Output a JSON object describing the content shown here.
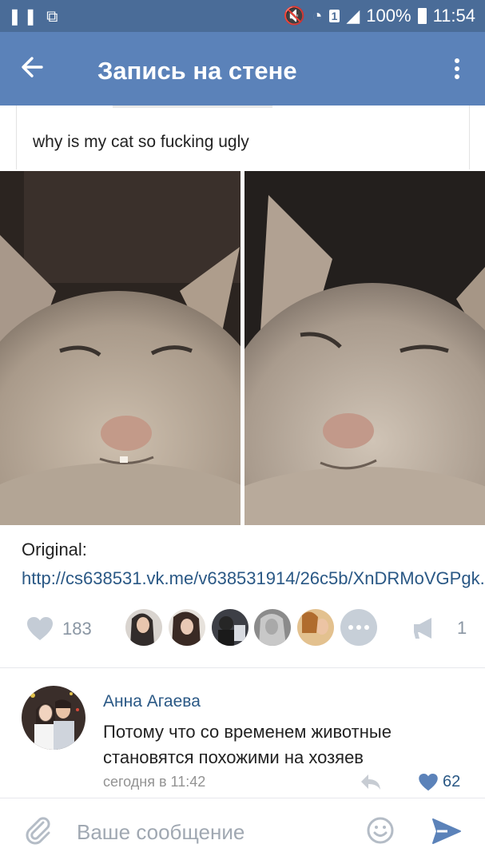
{
  "status_bar": {
    "left_icons": "❚❚ ⧉",
    "sim_label": "1",
    "battery_percent": "100%",
    "time": "11:54"
  },
  "app_bar": {
    "title": "Запись на стене"
  },
  "post": {
    "tweet_text": "why is my cat so fucking ugly",
    "caption_label": "Original:",
    "caption_link": "http://cs638531.vk.me/v638531914/26c5b/XnDRMoVGPgk....",
    "likes_count": "183",
    "shares_count": "1"
  },
  "comment": {
    "author": "Анна Агаева",
    "text": "Потому что со временем животные становятся похожими на хозяев",
    "date": "сегодня в 11:42",
    "likes": "62"
  },
  "composer": {
    "placeholder": "Ваше сообщение"
  },
  "colors": {
    "status_bar": "#4a6c98",
    "app_bar": "#5b82b9",
    "link": "#2a5885",
    "muted": "#8a96a3"
  }
}
